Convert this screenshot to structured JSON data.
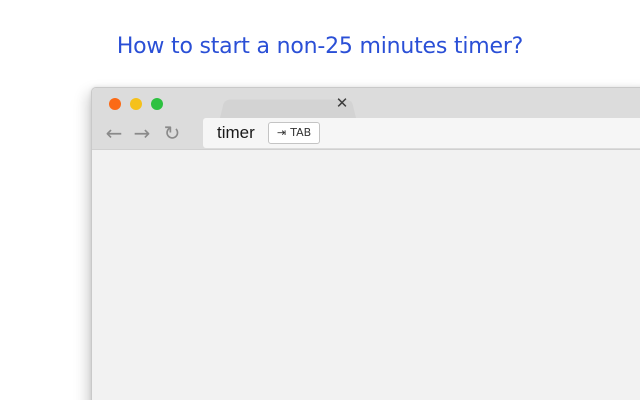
{
  "headline": "How to start a non-25 minutes timer?",
  "window": {
    "traffic_lights": {
      "close_color": "#fb6a16",
      "minimize_color": "#f5c11b",
      "maximize_color": "#2dc140"
    },
    "tab": {
      "close_glyph": "✕"
    },
    "toolbar": {
      "back_icon": "back-arrow-icon",
      "back_glyph": "←",
      "forward_icon": "forward-arrow-icon",
      "forward_glyph": "→",
      "reload_icon": "reload-icon",
      "reload_glyph": "↻"
    },
    "omnibox": {
      "value": "timer",
      "key_hint_arrow": "⇥",
      "key_hint_label": "TAB"
    }
  },
  "colors": {
    "headline": "#2a4fd6",
    "chrome": "#dcdcdc",
    "content": "#f2f2f2"
  }
}
